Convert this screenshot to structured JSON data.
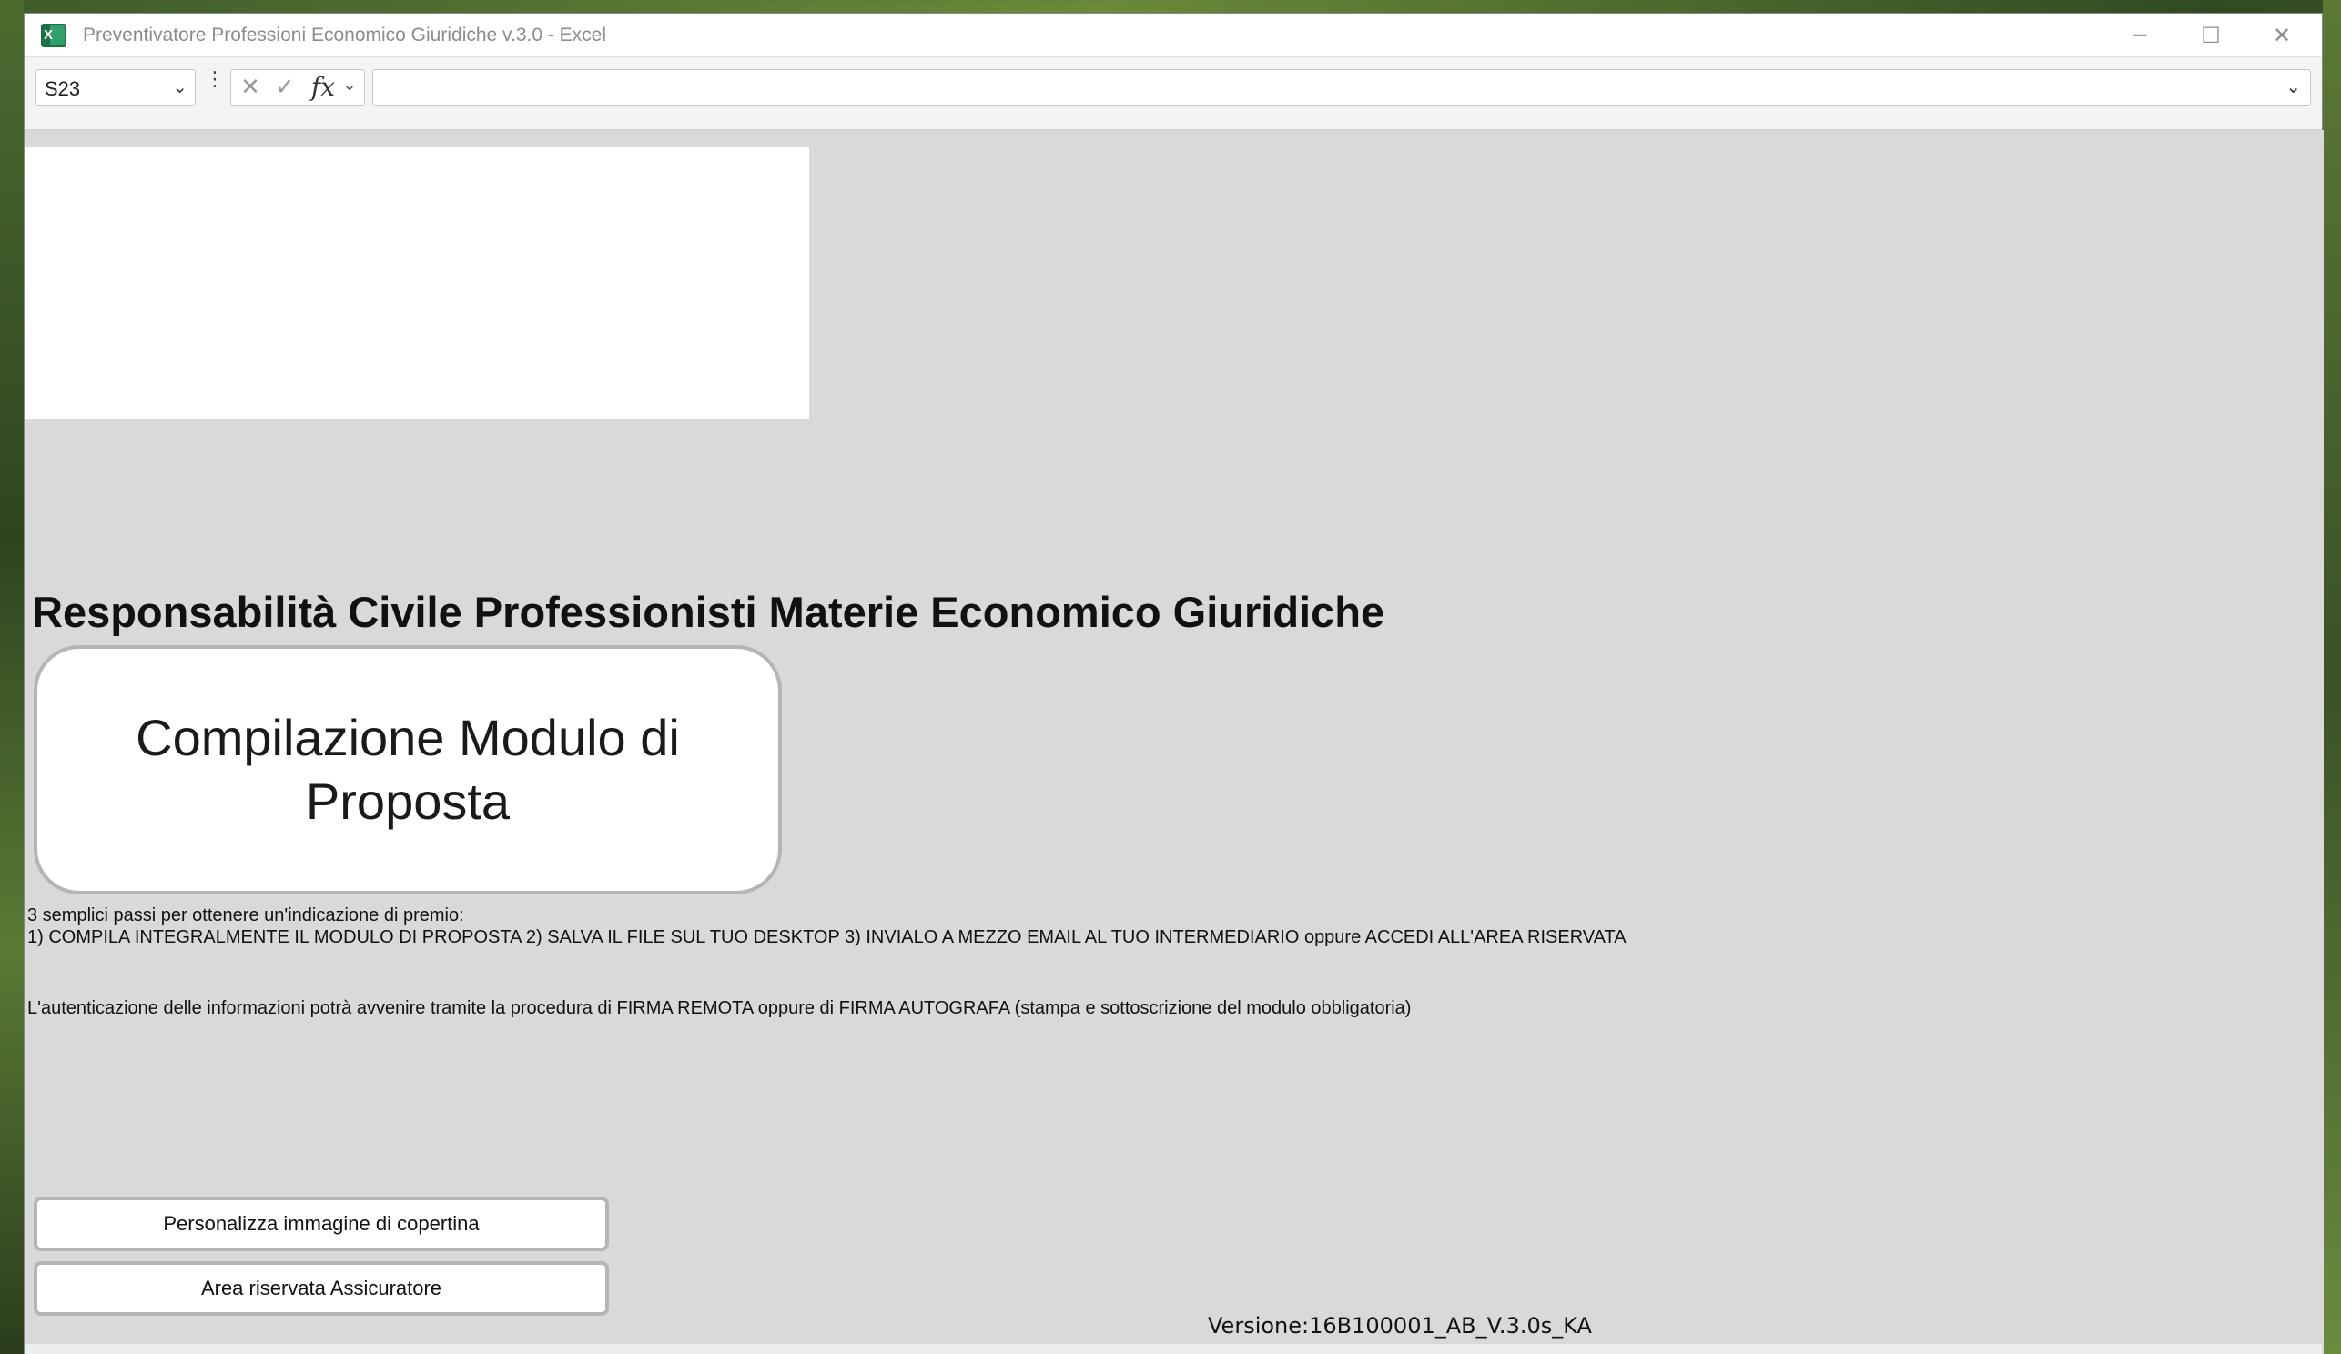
{
  "window": {
    "title": "Preventivatore Professioni Economico Giuridiche v.3.0 - Excel",
    "app_icon": "excel-icon",
    "controls": {
      "minimize": "─",
      "maximize": "☐",
      "close": "✕"
    }
  },
  "formula_bar": {
    "name_box_value": "S23",
    "name_box_dropdown_icon": "chevron-down-icon",
    "more_icon": "⋮",
    "cancel_icon": "✕",
    "enter_icon": "✓",
    "function_icon": "fx",
    "function_dropdown_icon": "⌄",
    "formula_value": "",
    "expand_icon": "⌄"
  },
  "sheet": {
    "heading": "Responsabilità Civile Professionisti Materie Economico Giuridiche",
    "main_button_label": "Compilazione Modulo di Proposta",
    "info_line_1": "3 semplici passi per ottenere un'indicazione di premio:",
    "info_line_2": "1) COMPILA INTEGRALMENTE IL MODULO DI PROPOSTA  2) SALVA IL FILE SUL TUO DESKTOP 3) INVIALO A MEZZO EMAIL AL TUO INTERMEDIARIO oppure ACCEDI ALL'AREA RISERVATA",
    "info_line_3": "L'autenticazione delle informazioni potrà avvenire tramite la procedura di FIRMA REMOTA oppure di FIRMA AUTOGRAFA (stampa e sottoscrizione del modulo obbligatoria)",
    "button_cover": "Personalizza immagine di copertina",
    "button_area": "Area riservata Assicuratore",
    "version": "Versione:16B100001_AB_V.3.0s_KA"
  },
  "colors": {
    "sheet_background": "#d9d9d9",
    "button_background": "#ffffff",
    "button_border": "#b5b5b5",
    "excel_green": "#1e7145"
  }
}
